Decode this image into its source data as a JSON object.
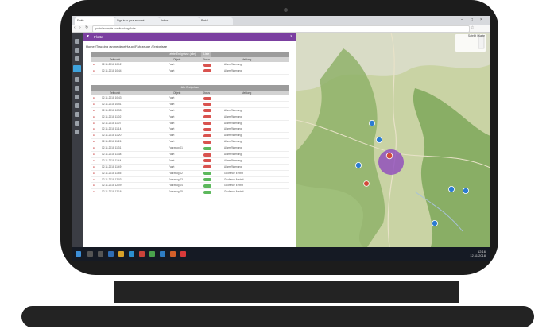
{
  "browser": {
    "tabs": [
      {
        "label": "Flotte - ..."
      },
      {
        "label": "Sign in to your account - ..."
      },
      {
        "label": "Inbox - ..."
      },
      {
        "label": "Portal"
      }
    ],
    "address": "portal.example.com/tracking/flotte"
  },
  "panel": {
    "title": "Flotte",
    "close": "×",
    "breadcrumb": "Home  /Tracking  /anmeldeortHaupt/Fahrzeuge  /Ereignisse"
  },
  "table_top": {
    "caption": "Letzte Ereignisse (alle)",
    "caption_tab": "Liste",
    "headers": [
      "Zeitpunkt",
      "Objekt",
      "Status",
      "Meldung"
    ],
    "rows": [
      {
        "time": "12.11.2018 10:12",
        "object": "Fahrt",
        "status_color": "#d9534f",
        "message": "Alarm/Warnung"
      },
      {
        "time": "12.11.2018 10:44",
        "object": "Fahrt",
        "status_color": "#d9534f",
        "message": "Alarm/Warnung"
      }
    ]
  },
  "table_bottom": {
    "caption": "Alle Ereignisse",
    "headers": [
      "Zeitpunkt",
      "Objekt",
      "Status",
      "Meldung"
    ],
    "rows": [
      {
        "time": "12.11.2018 10:43",
        "object": "Fahrt",
        "status_color": "#d9534f",
        "message": ""
      },
      {
        "time": "12.11.2018 10:51",
        "object": "Fahrt",
        "status_color": "#d9534f",
        "message": ""
      },
      {
        "time": "12.11.2018 10:55",
        "object": "Fahrt",
        "status_color": "#d9534f",
        "message": "Alarm/Warnung"
      },
      {
        "time": "12.11.2018 11:02",
        "object": "Fahrt",
        "status_color": "#d9534f",
        "message": "Alarm/Warnung"
      },
      {
        "time": "12.11.2018 11:07",
        "object": "Fahrt",
        "status_color": "#d9534f",
        "message": "Alarm/Warnung"
      },
      {
        "time": "12.11.2018 11:14",
        "object": "Fahrt",
        "status_color": "#d9534f",
        "message": "Alarm/Warnung"
      },
      {
        "time": "12.11.2018 11:20",
        "object": "Fahrt",
        "status_color": "#d9534f",
        "message": "Alarm/Warnung"
      },
      {
        "time": "12.11.2018 11:26",
        "object": "Fahrt",
        "status_color": "#d9534f",
        "message": "Alarm/Warnung"
      },
      {
        "time": "12.11.2018 11:31",
        "object": "Fahrzeug 01",
        "status_color": "#5cb85c",
        "message": "Alarm/Warnung"
      },
      {
        "time": "12.11.2018 11:38",
        "object": "Fahrt",
        "status_color": "#d9534f",
        "message": "Alarm/Warnung"
      },
      {
        "time": "12.11.2018 11:44",
        "object": "Fahrt",
        "status_color": "#d9534f",
        "message": "Alarm/Warnung"
      },
      {
        "time": "12.11.2018 11:49",
        "object": "Fahrt",
        "status_color": "#d9534f",
        "message": "Alarm/Warnung"
      },
      {
        "time": "12.11.2018 11:55",
        "object": "Fahrzeug 02",
        "status_color": "#5cb85c",
        "message": "Geofence Eintritt"
      },
      {
        "time": "12.11.2018 12:03",
        "object": "Fahrzeug 03",
        "status_color": "#5cb85c",
        "message": "Geofence Austritt"
      },
      {
        "time": "12.11.2018 12:09",
        "object": "Fahrzeug 04",
        "status_color": "#5cb85c",
        "message": "Geofence Eintritt"
      },
      {
        "time": "12.11.2018 12:16",
        "object": "Fahrzeug 05",
        "status_color": "#5cb85c",
        "message": "Geofence Austritt"
      }
    ]
  },
  "map": {
    "scale": "Satellit / Karte"
  },
  "taskbar": {
    "time": "12:16",
    "date": "12.11.2018"
  }
}
